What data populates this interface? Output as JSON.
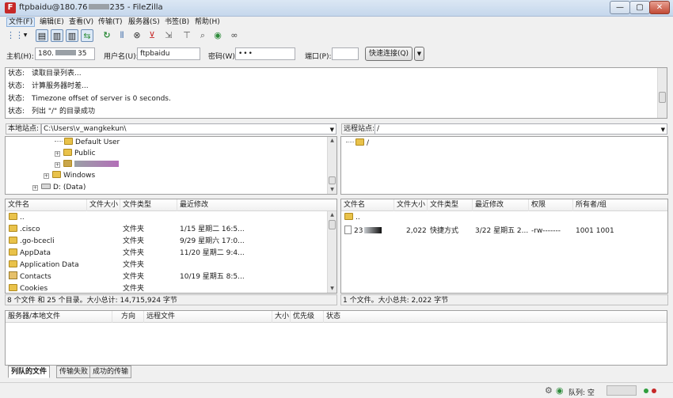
{
  "window": {
    "title": "ftpbaidu@180.76",
    "title_rest": "235 - FileZilla",
    "app_icon_letter": "F",
    "min_glyph": "—",
    "max_glyph": "▢",
    "close_glyph": "✕"
  },
  "menu": [
    "文件(F)",
    "编辑(E)",
    "查看(V)",
    "传输(T)",
    "服务器(S)",
    "书签(B)",
    "帮助(H)"
  ],
  "quickconnect": {
    "host_label": "主机(H):",
    "host_value": "180.",
    "host_value_tail": "35",
    "user_label": "用户名(U):",
    "user_value": "ftpbaidu",
    "pass_label": "密码(W):",
    "pass_value": "•••",
    "port_label": "端口(P):",
    "port_value": "",
    "connect_button": "快速连接(Q)",
    "dropdown_glyph": "▼"
  },
  "log": [
    {
      "label": "状态:",
      "text": "读取目录列表..."
    },
    {
      "label": "状态:",
      "text": "计算服务器时差..."
    },
    {
      "label": "状态:",
      "text": "Timezone offset of server is 0 seconds."
    },
    {
      "label": "状态:",
      "text": "列出 \"/\" 的目录成功"
    }
  ],
  "local": {
    "site_label": "本地站点:",
    "path": "C:\\Users\\v_wangkekun\\",
    "tree": [
      "Default User",
      "Public",
      "",
      "Windows",
      "D: (Data)"
    ],
    "columns": [
      "文件名",
      "文件大小",
      "文件类型",
      "最近修改"
    ],
    "rows": [
      {
        "name": "..",
        "size": "",
        "type": "",
        "modified": ""
      },
      {
        "name": ".cisco",
        "size": "",
        "type": "文件夹",
        "modified": "1/15 星期二 16:5..."
      },
      {
        "name": ".go-bcecli",
        "size": "",
        "type": "文件夹",
        "modified": "9/29 星期六 17:0..."
      },
      {
        "name": "AppData",
        "size": "",
        "type": "文件夹",
        "modified": "11/20 星期二 9:4..."
      },
      {
        "name": "Application Data",
        "size": "",
        "type": "文件夹",
        "modified": ""
      },
      {
        "name": "Contacts",
        "size": "",
        "type": "文件夹",
        "modified": "10/19 星期五 8:5..."
      },
      {
        "name": "Cookies",
        "size": "",
        "type": "文件夹",
        "modified": ""
      }
    ],
    "status": "8 个文件 和 25 个目录。大小总计: 14,715,924 字节"
  },
  "remote": {
    "site_label": "远程站点:",
    "path": "/",
    "tree": [
      "/"
    ],
    "columns": [
      "文件名",
      "文件大小",
      "文件类型",
      "最近修改",
      "权限",
      "所有者/组"
    ],
    "rows": [
      {
        "name": "..",
        "size": "",
        "type": "",
        "modified": "",
        "perm": "",
        "owner": ""
      },
      {
        "name": "23",
        "size": "2,022",
        "type": "快捷方式",
        "modified": "3/22 星期五 2...",
        "perm": "-rw-------",
        "owner": "1001 1001"
      }
    ],
    "status": "1 个文件。大小总共: 2,022 字节"
  },
  "queue": {
    "columns": [
      "服务器/本地文件",
      "方向",
      "远程文件",
      "大小",
      "优先级",
      "状态"
    ]
  },
  "tabs": [
    "列队的文件",
    "传输失败",
    "成功的传输"
  ],
  "statusbar": {
    "queue_label": "队列: 空"
  },
  "colors": {
    "folder": "#e9c24a",
    "led_green": "#2e9e3e",
    "led_red": "#c62828"
  }
}
